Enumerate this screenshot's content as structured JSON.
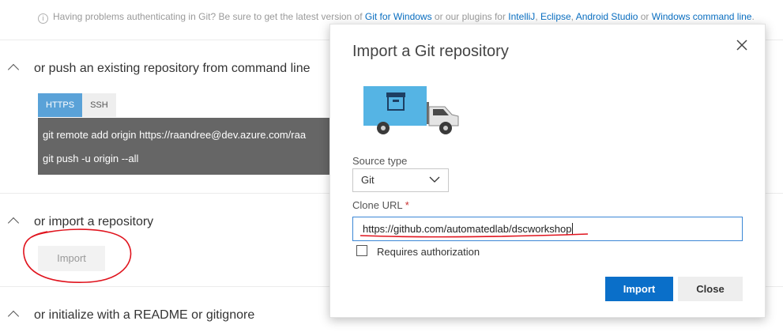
{
  "notice": {
    "icon": "info-icon",
    "pre": "Having problems authenticating in Git? Be sure to get the latest version of ",
    "link1": "Git for Windows",
    "mid1": " or our plugins for ",
    "link2": "IntelliJ",
    "sep1": ", ",
    "link3": "Eclipse",
    "sep2": ", ",
    "link4": "Android Studio",
    "mid2": " or ",
    "link5": "Windows command line",
    "end": "."
  },
  "sections": {
    "push": {
      "title": "or push an existing repository from command line",
      "tabs": [
        "HTTPS",
        "SSH"
      ],
      "commands": [
        "git remote add origin https://raandree@dev.azure.com/raa",
        "git push -u origin --all"
      ]
    },
    "import": {
      "title": "or import a repository",
      "button": "Import"
    },
    "initialize": {
      "title": "or initialize with a README or gitignore"
    }
  },
  "dialog": {
    "title": "Import a Git repository",
    "source_type_label": "Source type",
    "source_type_value": "Git",
    "clone_url_label": "Clone URL",
    "required_mark": "*",
    "clone_url_value": "https://github.com/automatedlab/dscworkshop",
    "requires_auth_label": "Requires authorization",
    "requires_auth_checked": false,
    "import_button": "Import",
    "close_button": "Close"
  },
  "colors": {
    "accent": "#0a6fc9",
    "tab_active": "#5aa2d8",
    "command_bg": "#666666",
    "annotation": "#e0141e",
    "truck_box": "#55b4e4"
  }
}
